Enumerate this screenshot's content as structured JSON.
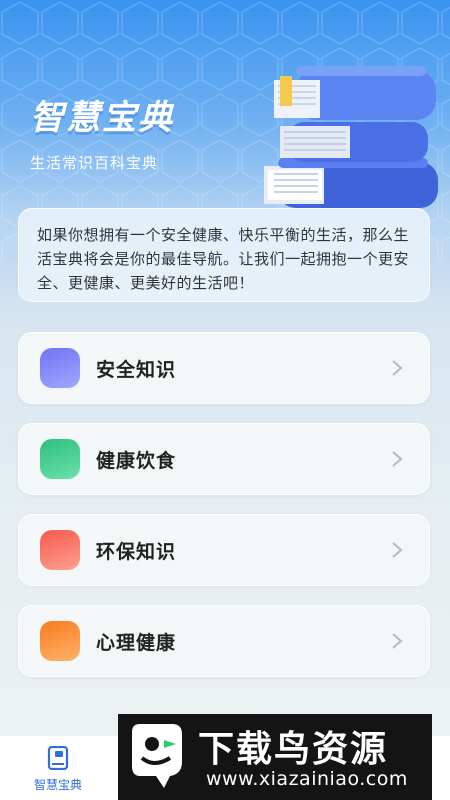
{
  "hero": {
    "title": "智慧宝典",
    "subtitle": "生活常识百科宝典"
  },
  "intro": {
    "text": "如果你想拥有一个安全健康、快乐平衡的生活，那么生活宝典将会是你的最佳导航。让我们一起拥抱一个更安全、更健康、更美好的生活吧！"
  },
  "menu": {
    "items": [
      {
        "label": "安全知识",
        "icon": "safety-icon",
        "color": "#6f73f2"
      },
      {
        "label": "健康饮食",
        "icon": "diet-icon",
        "color": "#3ec98a"
      },
      {
        "label": "环保知识",
        "icon": "eco-icon",
        "color": "#f66e5e"
      },
      {
        "label": "心理健康",
        "icon": "mind-icon",
        "color": "#f88a2e"
      }
    ]
  },
  "tabbar": {
    "tabs": [
      {
        "label": "智慧宝典",
        "icon": "book-icon",
        "active": true
      }
    ],
    "active_color": "#2f6fd8"
  },
  "watermark": {
    "main": "下载鸟资源",
    "sub": "www.xiazainiao.com"
  }
}
